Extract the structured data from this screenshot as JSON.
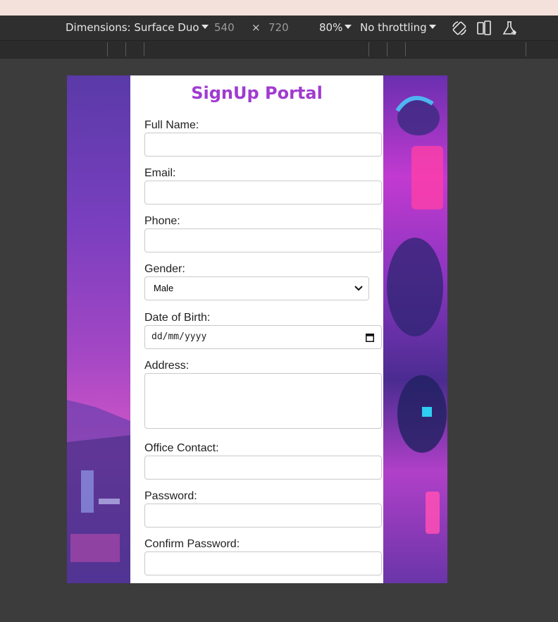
{
  "devtools": {
    "device_label": "Dimensions: Surface Duo",
    "width_value": "540",
    "times_symbol": "×",
    "height_value": "720",
    "zoom_label": "80%",
    "throttling_label": "No throttling"
  },
  "page": {
    "title": "SignUp Portal",
    "fields": {
      "full_name": {
        "label": "Full Name:",
        "value": ""
      },
      "email": {
        "label": "Email:",
        "value": ""
      },
      "phone": {
        "label": "Phone:",
        "value": ""
      },
      "gender": {
        "label": "Gender:",
        "selected": "Male"
      },
      "dob": {
        "label": "Date of Birth:",
        "placeholder": "dd/mm/yyyy"
      },
      "address": {
        "label": "Address:",
        "value": ""
      },
      "office_contact": {
        "label": "Office Contact:",
        "value": ""
      },
      "password": {
        "label": "Password:",
        "value": ""
      },
      "confirm_password": {
        "label": "Confirm Password:",
        "value": ""
      }
    }
  },
  "colors": {
    "title": "#a03bd0",
    "toolbar_bg": "#2f2f2f",
    "page_bg": "#3c3c3c"
  }
}
